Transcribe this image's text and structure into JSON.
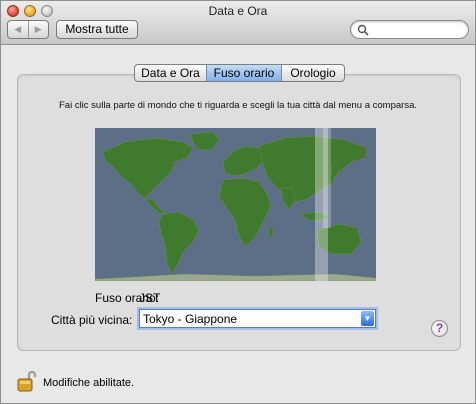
{
  "window": {
    "title": "Data e Ora"
  },
  "toolbar": {
    "back_glyph": "◀",
    "forward_glyph": "▶",
    "show_all_label": "Mostra tutte",
    "search_placeholder": ""
  },
  "tabs": [
    {
      "label": "Data e Ora",
      "selected": false
    },
    {
      "label": "Fuso orario",
      "selected": true
    },
    {
      "label": "Orologio",
      "selected": false
    }
  ],
  "timezone_pane": {
    "instruction": "Fai clic sulla parte di mondo che ti riguarda e scegli la tua città dal menu a comparsa.",
    "timezone_label": "Fuso orario:",
    "timezone_value": "JST",
    "city_label": "Città più vicina:",
    "city_value": "Tokyo - Giappone",
    "help_glyph": "?"
  },
  "footer": {
    "lock_text": "Modifiche abilitate."
  },
  "icons": {
    "close": "close-icon",
    "minimize": "minimize-icon",
    "zoom": "zoom-icon",
    "search": "search-icon",
    "lock": "lock-icon",
    "popup_arrow": "popup-arrow-icon"
  },
  "colors": {
    "selected_tab": "#7fb1eb",
    "map_ocean": "#5d6f87",
    "map_land": "#3f7a2f",
    "help_mark": "#7a3fb7"
  }
}
